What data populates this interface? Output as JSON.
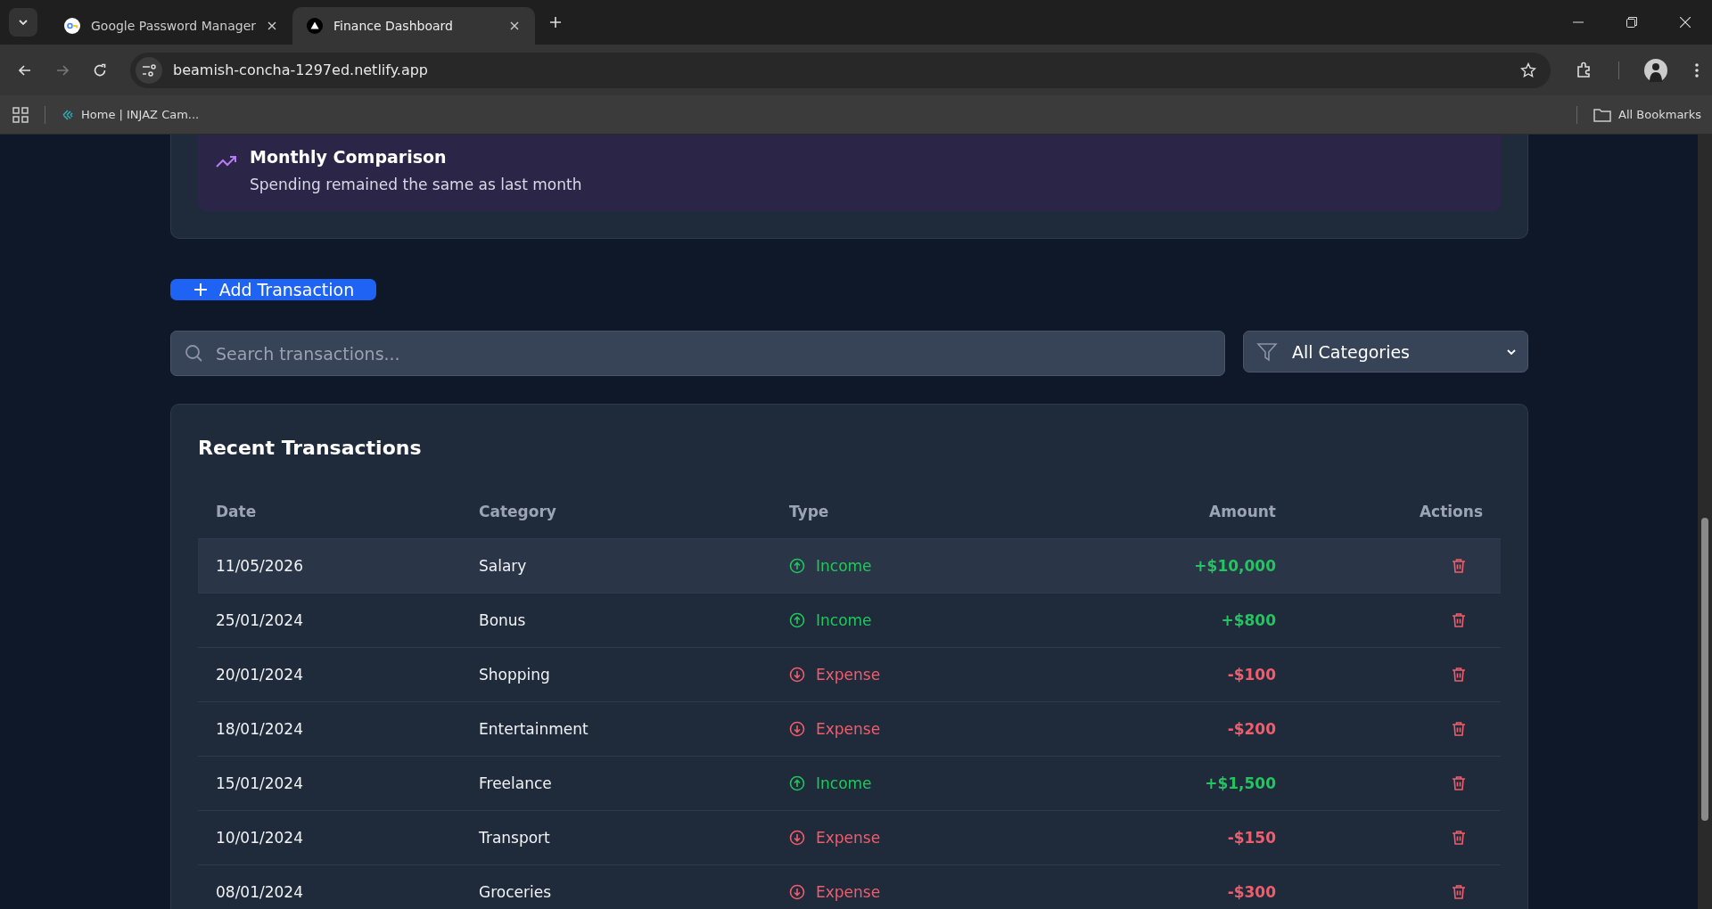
{
  "browser": {
    "tabs": [
      {
        "title": "Google Password Manager",
        "selected": false
      },
      {
        "title": "Finance Dashboard",
        "selected": true
      }
    ],
    "url": "beamish-concha-1297ed.netlify.app",
    "bookmarks": [
      {
        "label": "Home | INJAZ Cam..."
      }
    ],
    "all_bookmarks": "All Bookmarks"
  },
  "comparison": {
    "title": "Monthly Comparison",
    "text": "Spending remained the same as last month"
  },
  "add_button": "Add Transaction",
  "search": {
    "placeholder": "Search transactions..."
  },
  "category_filter": {
    "value": "All Categories"
  },
  "transactions": {
    "title": "Recent Transactions",
    "columns": [
      "Date",
      "Category",
      "Type",
      "Amount",
      "Actions"
    ],
    "rows": [
      {
        "date": "11/05/2026",
        "category": "Salary",
        "type": "Income",
        "kind": "income",
        "amount": "+$10,000",
        "selected": true
      },
      {
        "date": "25/01/2024",
        "category": "Bonus",
        "type": "Income",
        "kind": "income",
        "amount": "+$800",
        "selected": false
      },
      {
        "date": "20/01/2024",
        "category": "Shopping",
        "type": "Expense",
        "kind": "expense",
        "amount": "-$100",
        "selected": false
      },
      {
        "date": "18/01/2024",
        "category": "Entertainment",
        "type": "Expense",
        "kind": "expense",
        "amount": "-$200",
        "selected": false
      },
      {
        "date": "15/01/2024",
        "category": "Freelance",
        "type": "Income",
        "kind": "income",
        "amount": "+$1,500",
        "selected": false
      },
      {
        "date": "10/01/2024",
        "category": "Transport",
        "type": "Expense",
        "kind": "expense",
        "amount": "-$150",
        "selected": false
      },
      {
        "date": "08/01/2024",
        "category": "Groceries",
        "type": "Expense",
        "kind": "expense",
        "amount": "-$300",
        "selected": false
      }
    ]
  }
}
